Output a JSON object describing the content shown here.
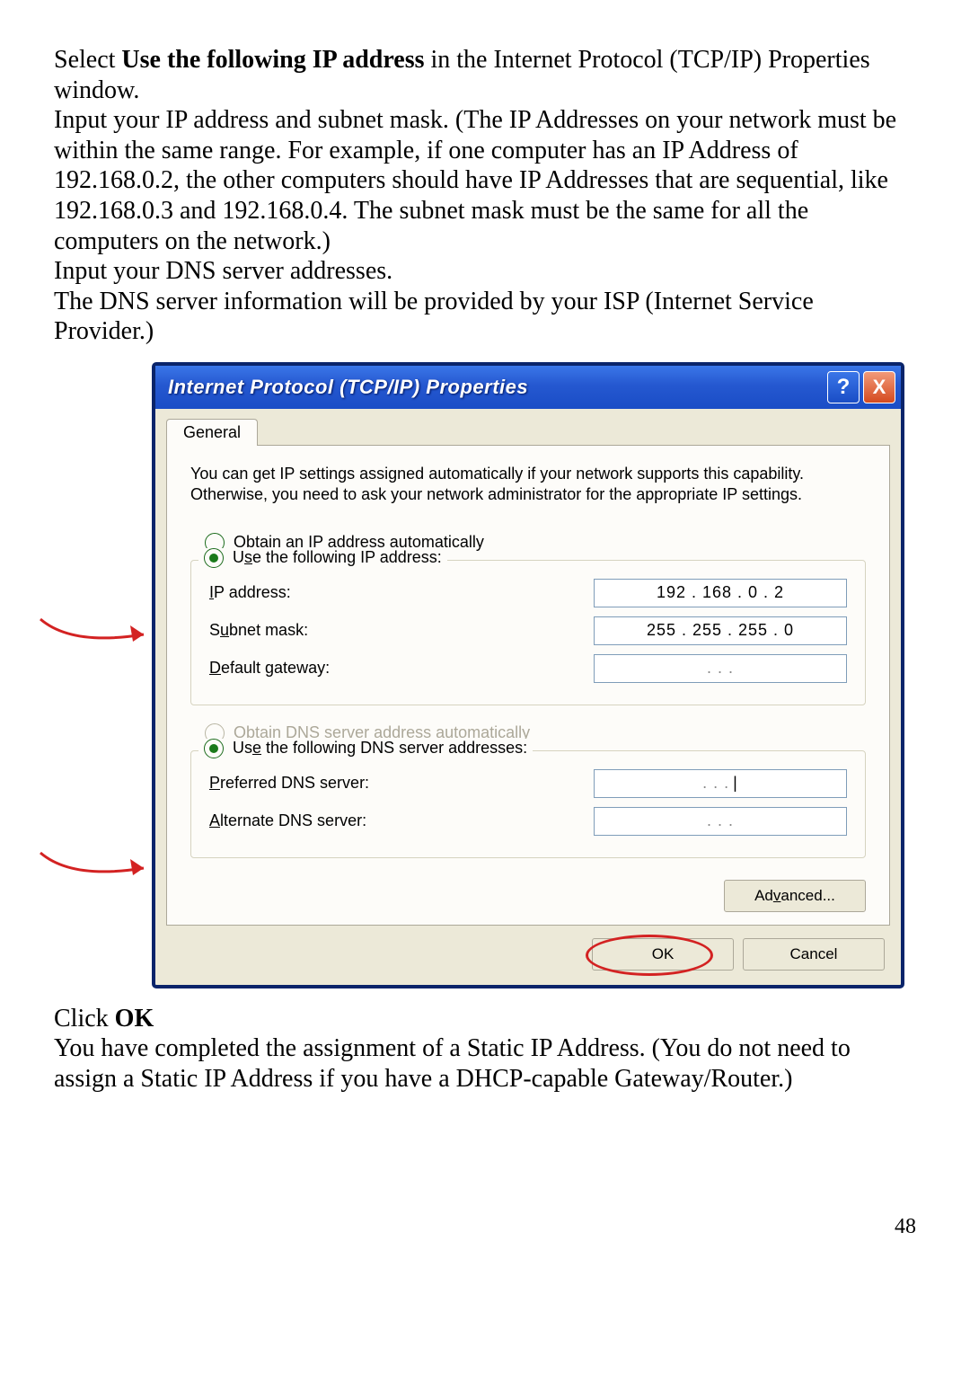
{
  "intro": {
    "p1_pre": "Select ",
    "p1_bold": "Use the following IP address",
    "p1_post": "  in the Internet Protocol (TCP/IP) Properties window.",
    "p2": "Input your IP address and subnet mask. (The IP Addresses on your network must be within the same range. For example, if one computer has an IP Address of 192.168.0.2, the other computers should have IP Addresses that are sequential, like 192.168.0.3 and 192.168.0.4.  The subnet mask must be the same for all the computers on the network.)",
    "p3": "Input your DNS server addresses.",
    "p4": "The DNS server information will be provided by your ISP (Internet Service Provider.)"
  },
  "dialog": {
    "title": "Internet Protocol (TCP/IP) Properties",
    "help_icon": "?",
    "close_icon": "X",
    "tab": "General",
    "description": "You can get IP settings assigned automatically if your network supports this capability. Otherwise, you need to ask your network administrator for the appropriate IP settings.",
    "radio_obtain_ip": "Obtain an IP address automatically",
    "radio_use_ip": "Use the following IP address:",
    "ip_label": "IP address:",
    "ip_value": "192 . 168 .   0   .   2",
    "subnet_label": "Subnet mask:",
    "subnet_value": "255 . 255 . 255 .   0",
    "gateway_label": "Default gateway:",
    "gateway_value": ".       .       .",
    "radio_obtain_dns": "Obtain DNS server address automatically",
    "radio_use_dns": "Use the following DNS server addresses:",
    "pref_dns_label": "Preferred DNS server:",
    "pref_dns_value": ".       .       .",
    "alt_dns_label": "Alternate DNS server:",
    "alt_dns_value": ".       .       .",
    "advanced": "Advanced...",
    "ok": "OK",
    "cancel": "Cancel"
  },
  "outro": {
    "click_pre": "Click ",
    "click_bold": "OK",
    "done": "You have completed the assignment of a Static IP Address.  (You do not need to assign a Static IP Address if you have a DHCP-capable Gateway/Router.)"
  },
  "page_number": "48"
}
